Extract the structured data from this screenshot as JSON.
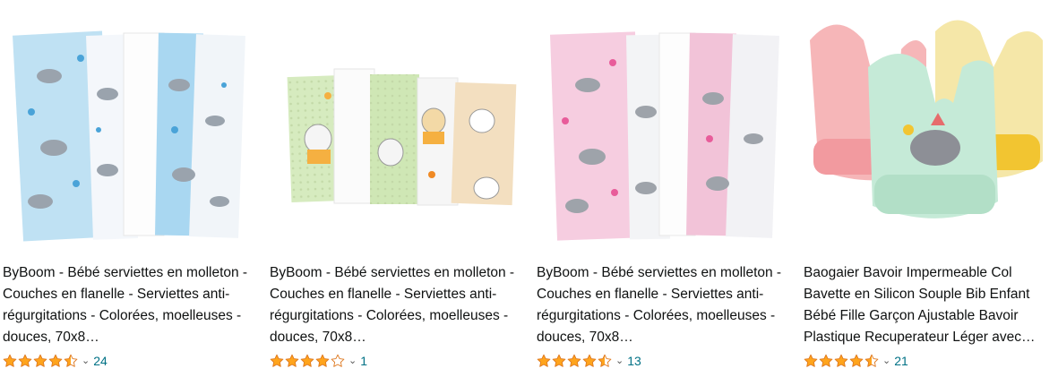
{
  "products": [
    {
      "title": "ByBoom - Bébé serviettes en molleton - Couches en flanelle - Serviettes anti-régurgitations - Colorées, moelleuses - douces, 70x8…",
      "rating": 4.5,
      "review_count": "24",
      "image_name": "blue-flannel-towels-image"
    },
    {
      "title": "ByBoom - Bébé serviettes en molleton - Couches en flanelle - Serviettes anti-régurgitations - Colorées, moelleuses - douces, 70x8…",
      "rating": 4,
      "review_count": "1",
      "image_name": "green-sheep-towels-image"
    },
    {
      "title": "ByBoom - Bébé serviettes en molleton - Couches en flanelle - Serviettes anti-régurgitations - Colorées, moelleuses - douces, 70x8…",
      "rating": 4.5,
      "review_count": "13",
      "image_name": "pink-flannel-towels-image"
    },
    {
      "title": "Baogaier Bavoir Impermeable Col Bavette en Silicon Souple Bib Enfant Bébé Fille Garçon Ajustable Bavoir Plastique Recuperateur Léger avec…",
      "rating": 4.5,
      "review_count": "21",
      "image_name": "silicone-bibs-image"
    }
  ],
  "colors": {
    "star": "#ffa41c",
    "link": "#007185",
    "text": "#0f1111"
  },
  "icons": {
    "star": "star-icon",
    "chevron": "chevron-down-icon"
  }
}
